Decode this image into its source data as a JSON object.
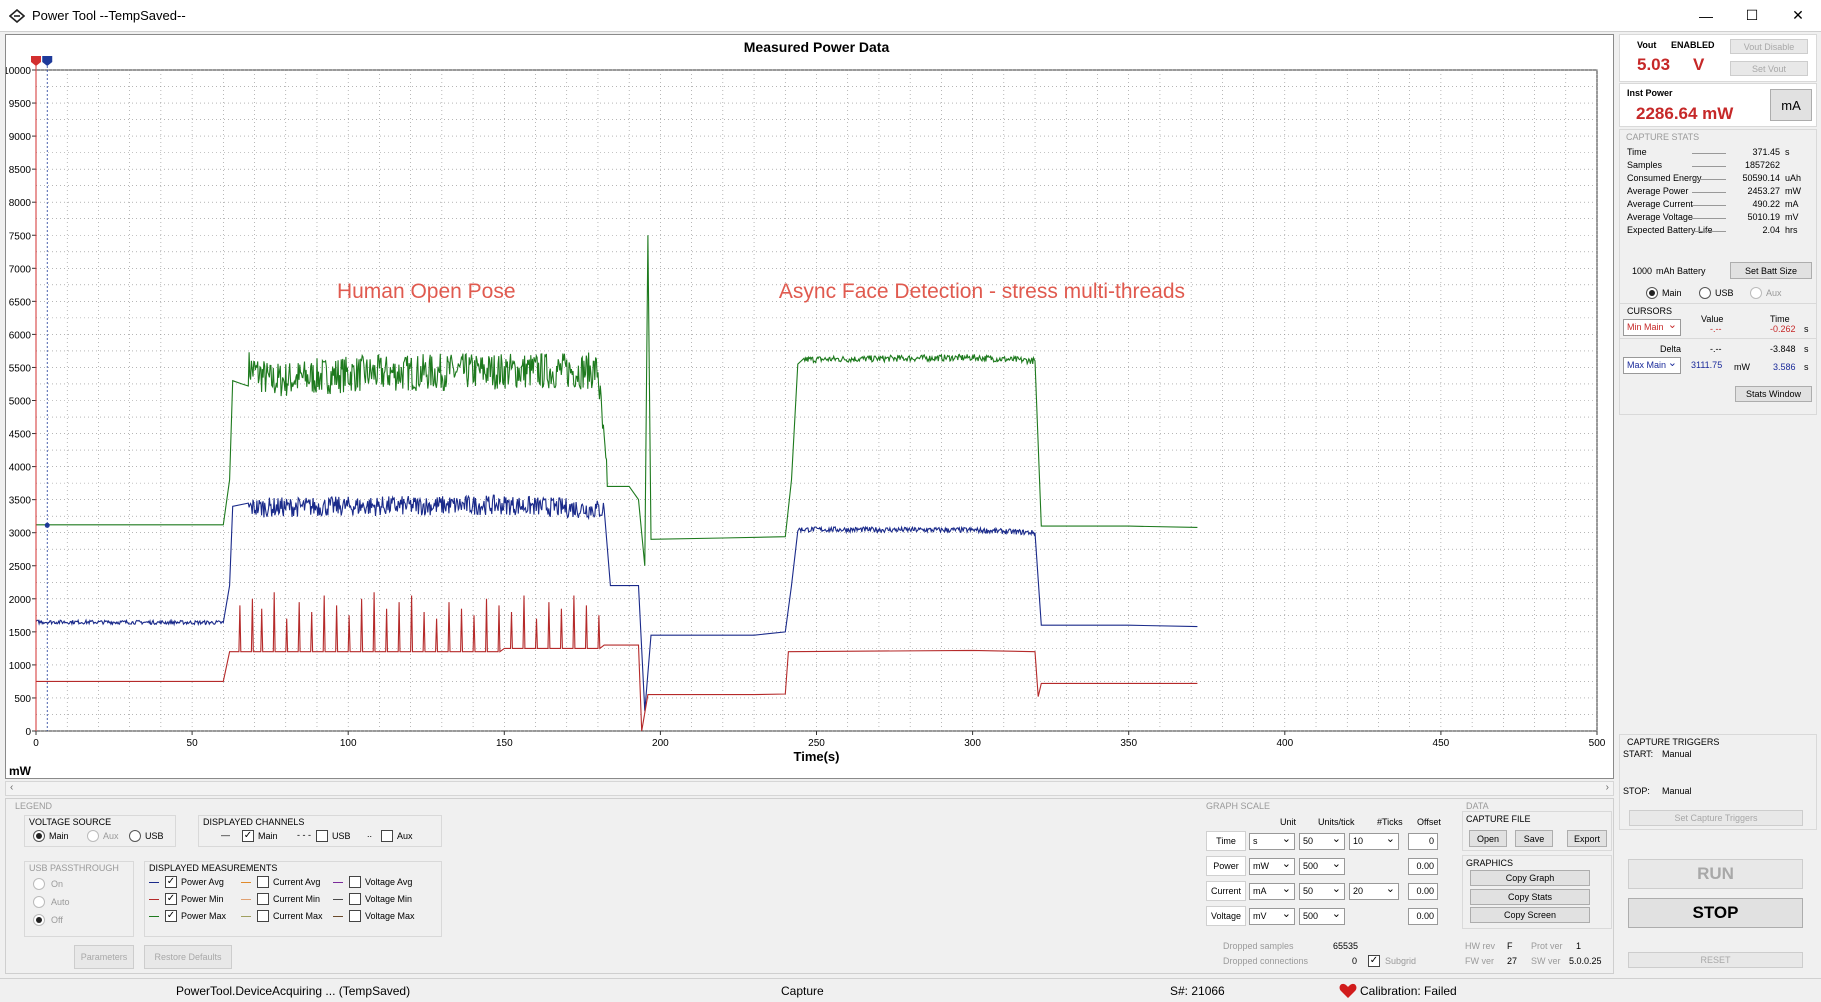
{
  "window": {
    "title": "Power Tool --TempSaved--",
    "minimize_glyph": "—",
    "maximize_glyph": "☐",
    "close_glyph": "✕"
  },
  "graph": {
    "unit_label": "mW",
    "marker_colors": [
      "#d32f2f",
      "#1e3a9a"
    ]
  },
  "chart_data": {
    "type": "line",
    "title": "Measured Power Data",
    "xlabel": "Time(s)",
    "ylabel": "mW",
    "xlim": [
      0,
      500
    ],
    "ylim": [
      0,
      10000
    ],
    "x_ticks": [
      0,
      50,
      100,
      150,
      200,
      250,
      300,
      350,
      400,
      450,
      500
    ],
    "y_ticks": [
      0,
      500,
      1000,
      1500,
      2000,
      2500,
      3000,
      3500,
      4000,
      4500,
      5000,
      5500,
      6000,
      6500,
      7000,
      7500,
      8000,
      8500,
      9000,
      9500,
      10000
    ],
    "grid": true,
    "annotations": [
      {
        "text": "Human Open Pose",
        "x": 125,
        "y": 6550,
        "color": "#e05a4f"
      },
      {
        "text": "Async Face Detection - stress multi-threads",
        "x": 303,
        "y": 6550,
        "color": "#e05a4f"
      }
    ],
    "series": [
      {
        "name": "Power Max",
        "color": "#1e7a1e",
        "points": [
          [
            0,
            3120
          ],
          [
            60,
            3120
          ],
          [
            62,
            3800
          ],
          [
            63,
            5300
          ],
          [
            66,
            5250
          ],
          [
            68,
            5500
          ],
          [
            75,
            5300
          ],
          [
            100,
            5400
          ],
          [
            150,
            5450
          ],
          [
            180,
            5450
          ],
          [
            183,
            3700
          ],
          [
            190,
            3700
          ],
          [
            193,
            3500
          ],
          [
            195,
            2500
          ],
          [
            196,
            7500
          ],
          [
            197,
            2900
          ],
          [
            220,
            2920
          ],
          [
            240,
            2940
          ],
          [
            242,
            3800
          ],
          [
            244,
            5550
          ],
          [
            246,
            5620
          ],
          [
            300,
            5650
          ],
          [
            320,
            5600
          ],
          [
            322,
            3100
          ],
          [
            350,
            3100
          ],
          [
            372,
            3080
          ]
        ],
        "noise": [
          [
            68,
            183,
            280
          ],
          [
            246,
            320,
            50
          ]
        ]
      },
      {
        "name": "Power Avg",
        "color": "#1a2a8a",
        "points": [
          [
            0,
            1650
          ],
          [
            60,
            1640
          ],
          [
            62,
            2200
          ],
          [
            63,
            3400
          ],
          [
            68,
            3380
          ],
          [
            100,
            3400
          ],
          [
            150,
            3420
          ],
          [
            182,
            3350
          ],
          [
            184,
            2200
          ],
          [
            193,
            2200
          ],
          [
            195,
            300
          ],
          [
            197,
            1450
          ],
          [
            230,
            1450
          ],
          [
            240,
            1500
          ],
          [
            242,
            2200
          ],
          [
            244,
            3050
          ],
          [
            300,
            3040
          ],
          [
            320,
            3000
          ],
          [
            322,
            1600
          ],
          [
            350,
            1600
          ],
          [
            372,
            1580
          ]
        ],
        "noise": [
          [
            68,
            182,
            150
          ],
          [
            0,
            60,
            30
          ],
          [
            244,
            320,
            40
          ]
        ]
      },
      {
        "name": "Power Min",
        "color": "#b52a2a",
        "points": [
          [
            0,
            750
          ],
          [
            60,
            750
          ],
          [
            62,
            1200
          ],
          [
            100,
            1200
          ],
          [
            150,
            1250
          ],
          [
            182,
            1300
          ],
          [
            193,
            1300
          ],
          [
            194,
            0
          ],
          [
            196,
            550
          ],
          [
            230,
            550
          ],
          [
            240,
            560
          ],
          [
            241,
            1200
          ],
          [
            300,
            1220
          ],
          [
            320,
            1200
          ],
          [
            321,
            520
          ],
          [
            322,
            720
          ],
          [
            350,
            720
          ],
          [
            372,
            720
          ]
        ],
        "spikes": [
          [
            65,
            1900
          ],
          [
            69,
            2000
          ],
          [
            72,
            1850
          ],
          [
            76,
            2100
          ],
          [
            80,
            1700
          ],
          [
            84,
            1950
          ],
          [
            88,
            1800
          ],
          [
            92,
            2050
          ],
          [
            96,
            1900
          ],
          [
            100,
            1750
          ],
          [
            104,
            2000
          ],
          [
            108,
            2100
          ],
          [
            112,
            1850
          ],
          [
            116,
            1950
          ],
          [
            120,
            2050
          ],
          [
            124,
            1800
          ],
          [
            128,
            1700
          ],
          [
            132,
            1950
          ],
          [
            136,
            1850
          ],
          [
            140,
            1750
          ],
          [
            144,
            2000
          ],
          [
            148,
            1900
          ],
          [
            152,
            1800
          ],
          [
            156,
            2050
          ],
          [
            160,
            1700
          ],
          [
            164,
            1950
          ],
          [
            168,
            1850
          ],
          [
            172,
            2050
          ],
          [
            176,
            1900
          ],
          [
            180,
            1750
          ]
        ]
      }
    ]
  },
  "vout": {
    "label": "Vout",
    "state": "ENABLED",
    "value": "5.03",
    "unit": "V",
    "disable_button": "Vout Disable",
    "set_button": "Set Vout"
  },
  "inst_power": {
    "label": "Inst Power",
    "value": "2286.64 mW",
    "unit_button": "mA"
  },
  "capture_stats": {
    "title": "CAPTURE STATS",
    "rows": [
      {
        "label": "Time",
        "value": "371.45",
        "unit": "s"
      },
      {
        "label": "Samples",
        "value": "1857262",
        "unit": ""
      },
      {
        "label": "Consumed Energy",
        "value": "50590.14",
        "unit": "uAh"
      },
      {
        "label": "Average Power",
        "value": "2453.27",
        "unit": "mW"
      },
      {
        "label": "Average Current",
        "value": "490.22",
        "unit": "mA"
      },
      {
        "label": "Average Voltage",
        "value": "5010.19",
        "unit": "mV"
      },
      {
        "label": "Expected Battery Life",
        "value": "2.04",
        "unit": "hrs"
      }
    ],
    "battery_value": "1000",
    "battery_label": "mAh Battery",
    "set_batt_button": "Set Batt Size",
    "channels": [
      "Main",
      "USB",
      "Aux"
    ]
  },
  "cursors": {
    "title": "CURSORS",
    "value_header": "Value",
    "time_header": "Time",
    "min_select": "Min Main",
    "min_value": "-.--",
    "min_time": "-0.262",
    "delta_label": "Delta",
    "delta_value": "-.--",
    "delta_time": "-3.848",
    "max_select": "Max Main",
    "max_value": "3111.75",
    "max_unit": "mW",
    "max_time": "3.586",
    "time_unit": "s",
    "stats_window_button": "Stats Window"
  },
  "capture_triggers": {
    "title": "CAPTURE TRIGGERS",
    "start_label": "START:",
    "start_value": "Manual",
    "stop_label": "STOP:",
    "stop_value": "Manual",
    "set_button": "Set Capture Triggers"
  },
  "run_button": "RUN",
  "stop_button": "STOP",
  "reset_button": "RESET",
  "legend": {
    "title": "LEGEND",
    "voltage_source": {
      "title": "VOLTAGE SOURCE",
      "options": [
        "Main",
        "Aux",
        "USB"
      ]
    },
    "displayed_channels": {
      "title": "DISPLAYED CHANNELS",
      "options": [
        "Main",
        "USB",
        "Aux"
      ],
      "line_styles": [
        "—",
        "- - -",
        ".."
      ]
    },
    "usb_passthrough": {
      "title": "USB PASSTHROUGH",
      "options": [
        "On",
        "Auto",
        "Off"
      ]
    },
    "displayed_measurements": {
      "title": "DISPLAYED MEASUREMENTS",
      "power": [
        {
          "label": "Power Avg",
          "color": "#1a2a8a"
        },
        {
          "label": "Power Min",
          "color": "#b52a2a"
        },
        {
          "label": "Power Max",
          "color": "#1e7a1e"
        }
      ],
      "current": [
        {
          "label": "Current Avg",
          "color": "#e08a2a"
        },
        {
          "label": "Current Min",
          "color": "#e0a070"
        },
        {
          "label": "Current Max",
          "color": "#a0a060"
        }
      ],
      "voltage": [
        {
          "label": "Voltage Avg",
          "color": "#7a2a9a"
        },
        {
          "label": "Voltage Min",
          "color": "#4a4a4a"
        },
        {
          "label": "Voltage Max",
          "color": "#6a4a2a"
        }
      ]
    },
    "parameters_button": "Parameters",
    "restore_button": "Restore Defaults"
  },
  "graph_scale": {
    "title": "GRAPH SCALE",
    "headers": [
      "Unit",
      "Units/tick",
      "#Ticks",
      "Offset"
    ],
    "rows": [
      {
        "label": "Time",
        "unit": "s",
        "units_tick": "50",
        "ticks": "10",
        "offset": "0"
      },
      {
        "label": "Power",
        "unit": "mW",
        "units_tick": "500",
        "ticks": "",
        "offset": "0.00"
      },
      {
        "label": "Current",
        "unit": "mA",
        "units_tick": "50",
        "ticks": "20",
        "offset": "0.00"
      },
      {
        "label": "Voltage",
        "unit": "mV",
        "units_tick": "500",
        "ticks": "",
        "offset": "0.00"
      }
    ],
    "dropped_samples_label": "Dropped samples",
    "dropped_samples_value": "65535",
    "dropped_connections_label": "Dropped connections",
    "dropped_connections_value": "0",
    "subgrid_label": "Subgrid"
  },
  "data_panel": {
    "title": "DATA",
    "capture_file_title": "CAPTURE FILE",
    "open_button": "Open",
    "save_button": "Save",
    "export_button": "Export",
    "graphics_title": "GRAPHICS",
    "copy_graph_button": "Copy Graph",
    "copy_stats_button": "Copy Stats",
    "copy_screen_button": "Copy Screen",
    "hw_rev_label": "HW rev",
    "hw_rev_value": "F",
    "prot_ver_label": "Prot ver",
    "prot_ver_value": "1",
    "fw_ver_label": "FW ver",
    "fw_ver_value": "27",
    "sw_ver_label": "SW ver",
    "sw_ver_value": "5.0.0.25"
  },
  "status": {
    "left": "PowerTool.DeviceAcquiring ... (TempSaved)",
    "middle": "Capture",
    "serial": "S#: 21066",
    "calibration": "Calibration: Failed"
  }
}
